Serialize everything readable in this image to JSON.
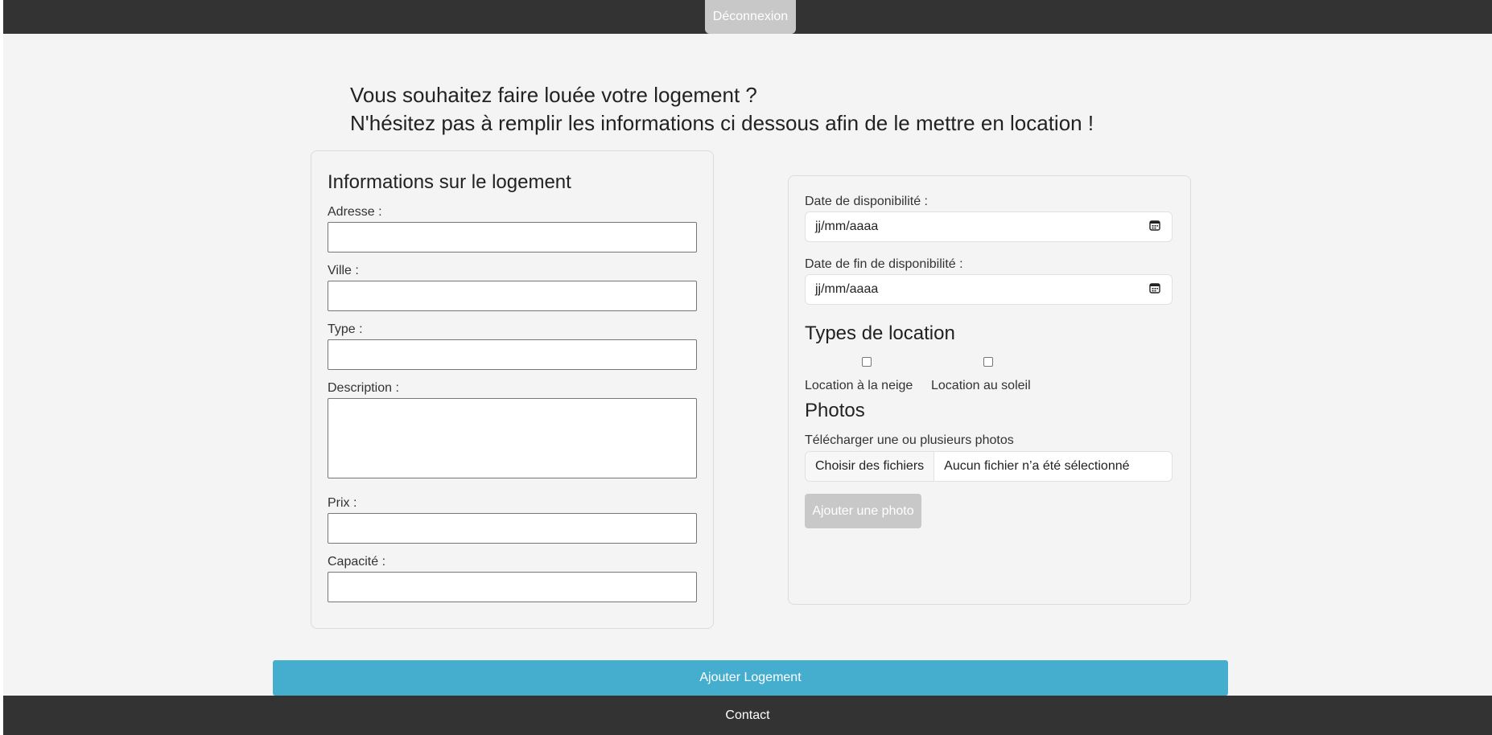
{
  "header": {
    "logout_label": "Déconnexion"
  },
  "intro": {
    "line1": "Vous souhaitez faire louée votre logement ?",
    "line2": "N'hésitez pas à remplir les informations ci dessous afin de le mettre en location !"
  },
  "housing": {
    "title": "Informations sur le logement",
    "address_label": "Adresse :",
    "address_value": "",
    "city_label": "Ville :",
    "city_value": "",
    "type_label": "Type :",
    "type_value": "",
    "description_label": "Description :",
    "description_value": "",
    "price_label": "Prix :",
    "price_value": "",
    "capacity_label": "Capacité :",
    "capacity_value": ""
  },
  "availability": {
    "start_label": "Date de disponibilité :",
    "start_placeholder": "jj/mm/aaaa",
    "end_label": "Date de fin de disponibilité :",
    "end_placeholder": "jj/mm/aaaa",
    "calendar_icon": "calendar-icon"
  },
  "rental_types": {
    "title": "Types de location",
    "options": [
      {
        "label": "Location à la neige",
        "checked": false
      },
      {
        "label": "Location au soleil",
        "checked": false
      }
    ]
  },
  "photos": {
    "title": "Photos",
    "upload_label": "Télécharger une ou plusieurs photos",
    "choose_button": "Choisir des fichiers",
    "file_status": "Aucun fichier n’a été sélectionné",
    "add_button": "Ajouter une photo"
  },
  "submit_label": "Ajouter Logement",
  "footer": {
    "contact_label": "Contact"
  },
  "colors": {
    "header_bg": "#333333",
    "submit_bg": "#45aecf",
    "disabled_button_bg": "#c8c8c8",
    "page_bg": "#f4f4f4"
  }
}
